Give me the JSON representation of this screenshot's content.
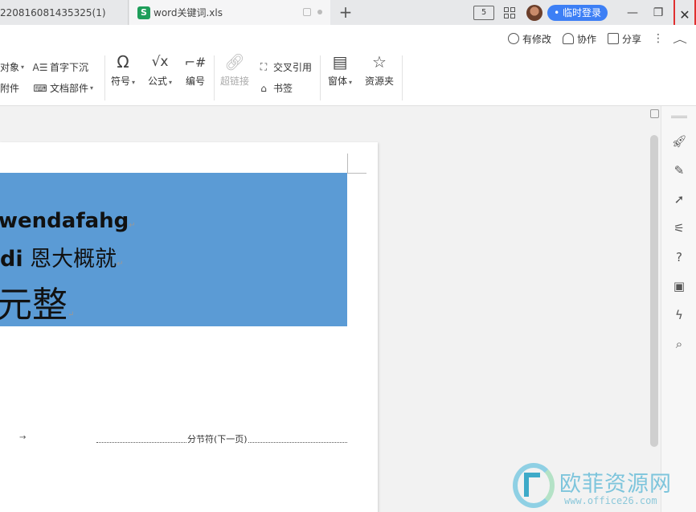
{
  "tabs": [
    {
      "label": "220816081435325(1)"
    },
    {
      "label": "word关键词.xls",
      "icon": "S"
    }
  ],
  "titlebar": {
    "reader_mode_label": "5",
    "login_button": "• 临时登录"
  },
  "toprow": {
    "changes": "有修改",
    "collab": "协作",
    "share": "分享"
  },
  "ribbon": {
    "object": "对象",
    "attachment": "附件",
    "dropcap": "首字下沉",
    "doc_parts": "文档部件",
    "symbol": "符号",
    "formula": "公式",
    "numbering": "编号",
    "hyperlink": "超链接",
    "cross_ref": "交叉引用",
    "bookmark": "书签",
    "form": "窗体",
    "resource": "资源夹"
  },
  "document": {
    "line1": "wendafahg",
    "line2_bold": "di",
    "line2_rest": " 恩大概就",
    "line3": "元整",
    "section_break": "分节符(下一页)",
    "highlight_color": "#5b9bd5"
  },
  "watermark": {
    "title": "欧菲资源网",
    "url": "www.office26.com"
  }
}
